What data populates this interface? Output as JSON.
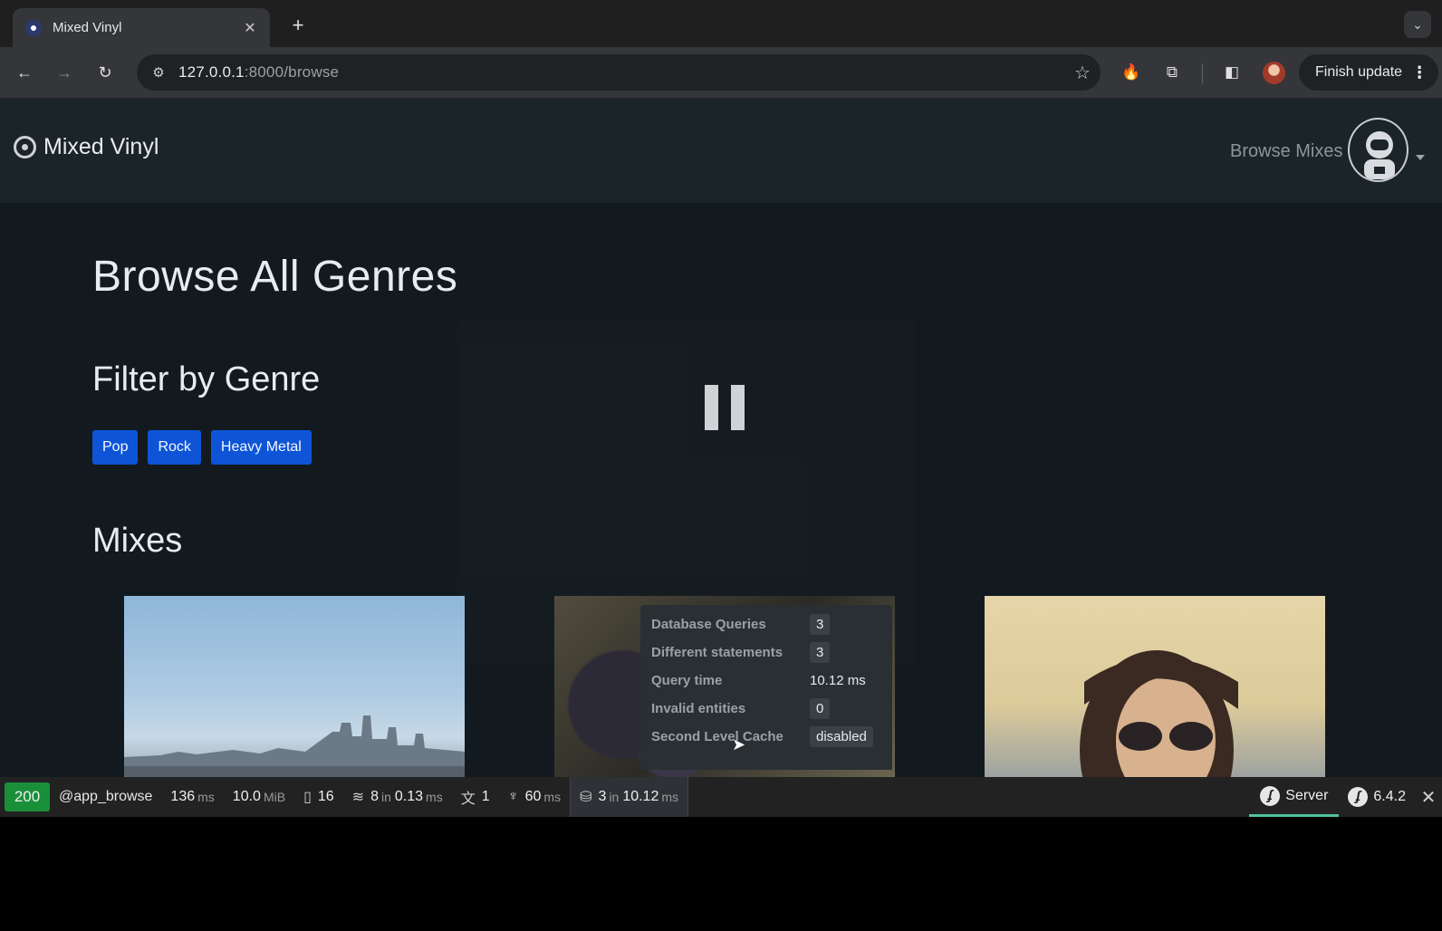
{
  "browser": {
    "tab_title": "Mixed Vinyl",
    "tab_close": "✕",
    "new_tab": "+",
    "url_host": "127.0.0.1",
    "url_rest": ":8000/browse",
    "finish_update_label": "Finish update",
    "menu_dots": "⋮"
  },
  "site": {
    "brand_name": "Mixed Vinyl",
    "nav_link": "Browse Mixes"
  },
  "main": {
    "title": "Browse All Genres",
    "filter_heading": "Filter by Genre",
    "genres": [
      "Pop",
      "Rock",
      "Heavy Metal"
    ],
    "mixes_heading": "Mixes"
  },
  "doctrine_panel": {
    "rows": [
      {
        "label": "Database Queries",
        "value": "3"
      },
      {
        "label": "Different statements",
        "value": "3"
      },
      {
        "label": "Query time",
        "value": "10.12 ms"
      },
      {
        "label": "Invalid entities",
        "value": "0"
      },
      {
        "label": "Second Level Cache",
        "value": "disabled"
      }
    ]
  },
  "debug_toolbar": {
    "status": "200",
    "route": "@app_browse",
    "time_value": "136",
    "time_unit": "ms",
    "memory_value": "10.0",
    "memory_unit": "MiB",
    "forms_count": "16",
    "cache_count": "8",
    "cache_in": "in",
    "cache_time": "0.13",
    "cache_unit": "ms",
    "translation_count": "1",
    "twig_time": "60",
    "twig_unit": "ms",
    "db_count": "3",
    "db_in": "in",
    "db_time": "10.12",
    "db_unit": "ms",
    "server_label": "Server",
    "symfony_version": "6.4.2",
    "close": "✕"
  }
}
